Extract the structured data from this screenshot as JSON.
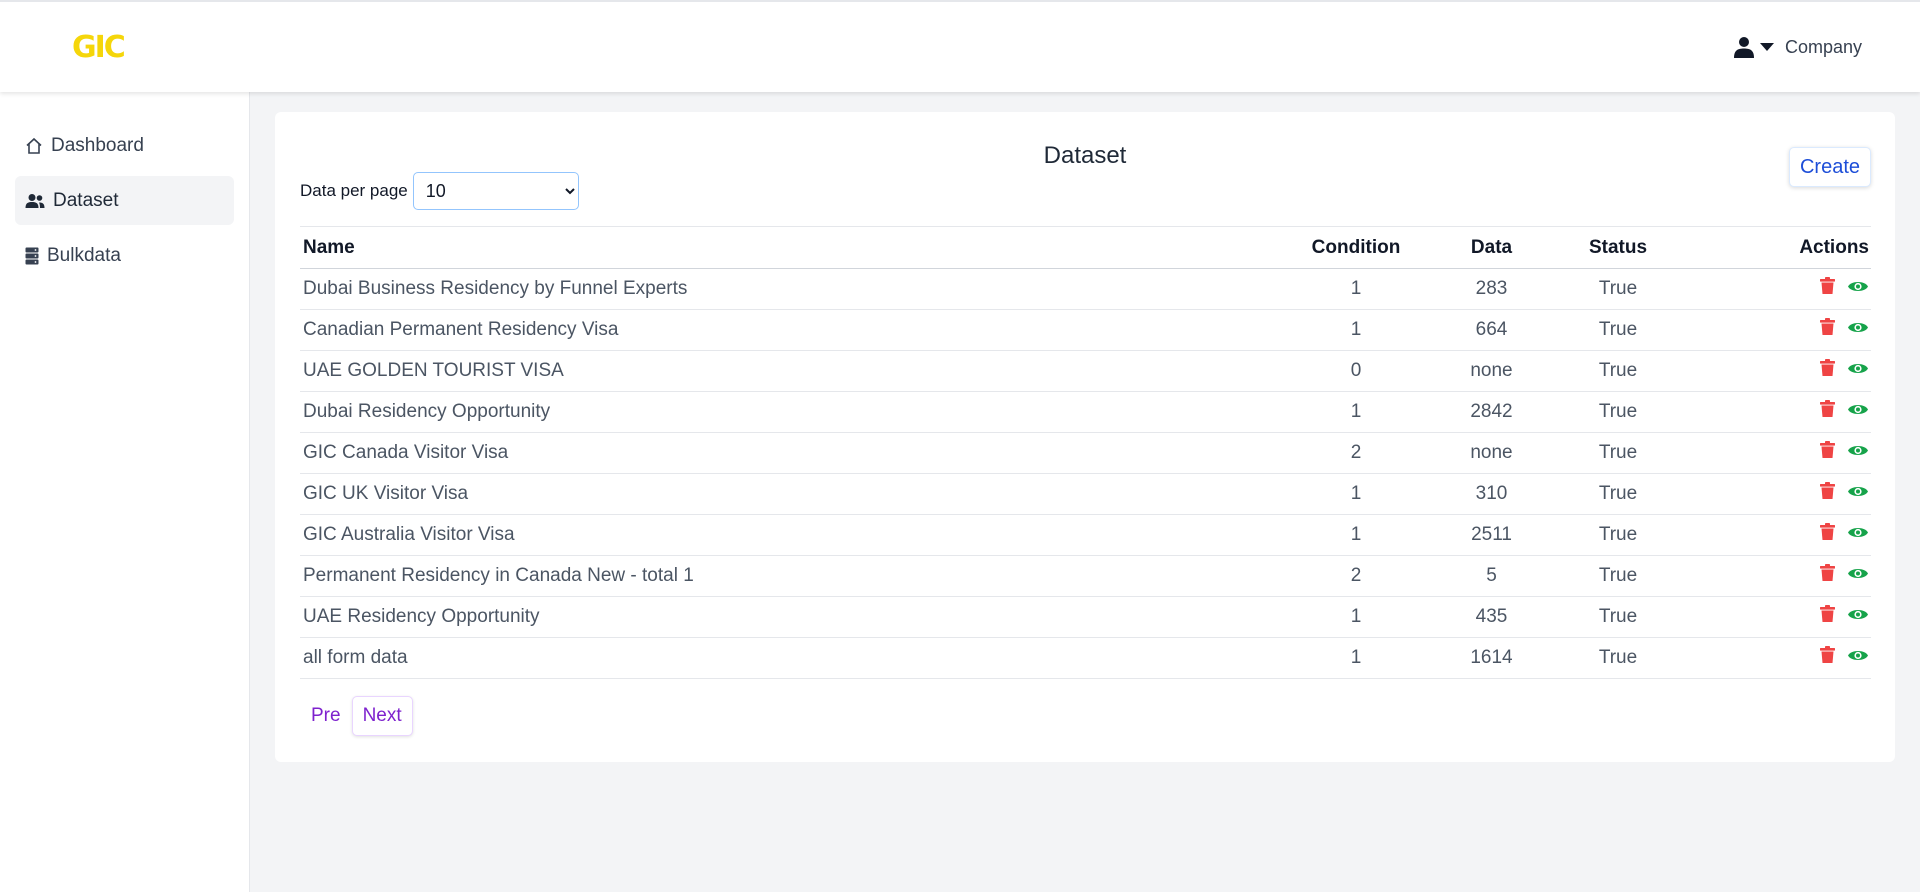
{
  "header": {
    "logo_text": "GIC",
    "user_menu_label": "Company"
  },
  "sidebar": {
    "items": [
      {
        "label": "Dashboard",
        "icon": "home-icon",
        "active": false
      },
      {
        "label": "Dataset",
        "icon": "users-icon",
        "active": true
      },
      {
        "label": "Bulkdata",
        "icon": "server-icon",
        "active": false
      }
    ]
  },
  "main": {
    "title": "Dataset",
    "create_label": "Create",
    "per_page_label": "Data per page",
    "per_page_value": "10",
    "columns": [
      "Name",
      "Condition",
      "Data",
      "Status",
      "Actions"
    ],
    "rows": [
      {
        "name": "Dubai Business Residency by Funnel Experts",
        "condition": "1",
        "data": "283",
        "status": "True"
      },
      {
        "name": "Canadian Permanent Residency Visa",
        "condition": "1",
        "data": "664",
        "status": "True"
      },
      {
        "name": "UAE GOLDEN TOURIST VISA",
        "condition": "0",
        "data": "none",
        "status": "True"
      },
      {
        "name": "Dubai Residency Opportunity",
        "condition": "1",
        "data": "2842",
        "status": "True"
      },
      {
        "name": "GIC Canada Visitor Visa",
        "condition": "2",
        "data": "none",
        "status": "True"
      },
      {
        "name": "GIC UK Visitor Visa",
        "condition": "1",
        "data": "310",
        "status": "True"
      },
      {
        "name": "GIC Australia Visitor Visa",
        "condition": "1",
        "data": "2511",
        "status": "True"
      },
      {
        "name": "Permanent Residency in Canada New - total 1",
        "condition": "2",
        "data": "5",
        "status": "True"
      },
      {
        "name": "UAE Residency Opportunity",
        "condition": "1",
        "data": "435",
        "status": "True"
      },
      {
        "name": "all form data",
        "condition": "1",
        "data": "1614",
        "status": "True"
      }
    ],
    "pager": {
      "prev_label": "Pre",
      "next_label": "Next"
    }
  },
  "colors": {
    "logo": "#f5d60a",
    "accent_blue": "#1d4ed8",
    "pager_purple": "#7e22ce",
    "delete_red": "#ef4444",
    "view_green": "#16a34a"
  }
}
